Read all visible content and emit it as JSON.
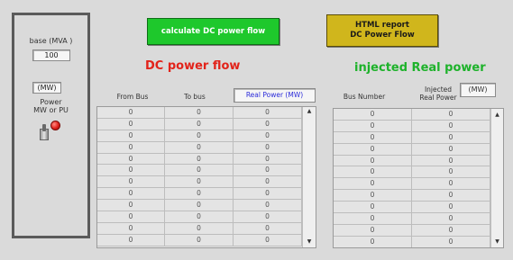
{
  "left_panel": {
    "base_label": "base (MVA )",
    "base_value": "100",
    "unit_value": "(MW)",
    "power_label_line1": "Power",
    "power_label_line2": "MW or PU"
  },
  "buttons": {
    "calculate_label": "calculate DC power flow",
    "report_label_line1": "HTML report",
    "report_label_line2": "DC Power Flow"
  },
  "dc_power_flow": {
    "title": "DC power flow",
    "col_from_bus": "From Bus",
    "col_to_bus": "To bus",
    "col_real_power": "Real Power (MW)",
    "rows": [
      [
        "0",
        "0",
        "0"
      ],
      [
        "0",
        "0",
        "0"
      ],
      [
        "0",
        "0",
        "0"
      ],
      [
        "0",
        "0",
        "0"
      ],
      [
        "0",
        "0",
        "0"
      ],
      [
        "0",
        "0",
        "0"
      ],
      [
        "0",
        "0",
        "0"
      ],
      [
        "0",
        "0",
        "0"
      ],
      [
        "0",
        "0",
        "0"
      ],
      [
        "0",
        "0",
        "0"
      ],
      [
        "0",
        "0",
        "0"
      ],
      [
        "0",
        "0",
        "0"
      ]
    ]
  },
  "injected_real_power": {
    "title": "injected Real power",
    "col_bus_number": "Bus Number",
    "col_injected_line1": "Injected",
    "col_injected_line2": "Real Power",
    "unit_value": "(MW)",
    "rows": [
      [
        "0",
        "0"
      ],
      [
        "0",
        "0"
      ],
      [
        "0",
        "0"
      ],
      [
        "0",
        "0"
      ],
      [
        "0",
        "0"
      ],
      [
        "0",
        "0"
      ],
      [
        "0",
        "0"
      ],
      [
        "0",
        "0"
      ],
      [
        "0",
        "0"
      ],
      [
        "0",
        "0"
      ],
      [
        "0",
        "0"
      ],
      [
        "0",
        "0"
      ]
    ]
  },
  "scroll": {
    "up_arrow": "▲",
    "down_arrow": "▼"
  },
  "colors": {
    "calculate_button": "#1ec82c",
    "report_button": "#d0b61c",
    "dc_title": "#e2231a",
    "injected_title": "#1db22a",
    "toggle_led": "#e0201a"
  }
}
